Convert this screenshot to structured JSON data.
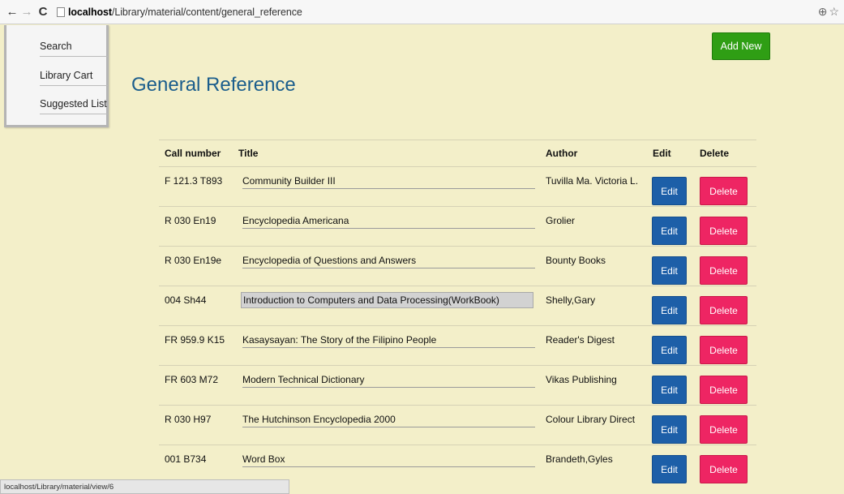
{
  "browser": {
    "url_host": "localhost",
    "url_path": "/Library/material/content/general_reference"
  },
  "sidebar": {
    "items": [
      {
        "label": "Search"
      },
      {
        "label": "Library Cart"
      },
      {
        "label": "Suggested List"
      }
    ]
  },
  "page": {
    "title": "General Reference",
    "add_button": "Add New"
  },
  "table": {
    "headers": [
      "Call number",
      "Title",
      "Author",
      "Edit",
      "Delete"
    ],
    "edit_label": "Edit",
    "delete_label": "Delete",
    "rows": [
      {
        "call_number": "F 121.3 T893",
        "title": "Community Builder III",
        "author": "Tuvilla Ma. Victoria L."
      },
      {
        "call_number": "R 030 En19",
        "title": "Encyclopedia Americana",
        "author": "Grolier"
      },
      {
        "call_number": "R 030 En19e",
        "title": "Encyclopedia of Questions and Answers",
        "author": "Bounty Books"
      },
      {
        "call_number": "004 Sh44",
        "title": "Introduction to Computers and Data Processing(WorkBook)",
        "author": "Shelly,Gary"
      },
      {
        "call_number": "FR 959.9 K15",
        "title": "Kasaysayan: The Story of the Filipino People",
        "author": "Reader's Digest"
      },
      {
        "call_number": "FR 603 M72",
        "title": "Modern Technical Dictionary",
        "author": "Vikas Publishing"
      },
      {
        "call_number": "R 030 H97",
        "title": "The Hutchinson Encyclopedia 2000",
        "author": "Colour Library Direct"
      },
      {
        "call_number": "001 B734",
        "title": "Word Box",
        "author": "Brandeth,Gyles"
      }
    ]
  },
  "statusbar": {
    "text": "localhost/Library/material/view/6"
  },
  "colors": {
    "background": "#f3efc9",
    "title": "#1a5d8c",
    "add_button": "#2f9e14",
    "edit_button": "#1d5fa8",
    "delete_button": "#ee2563"
  }
}
